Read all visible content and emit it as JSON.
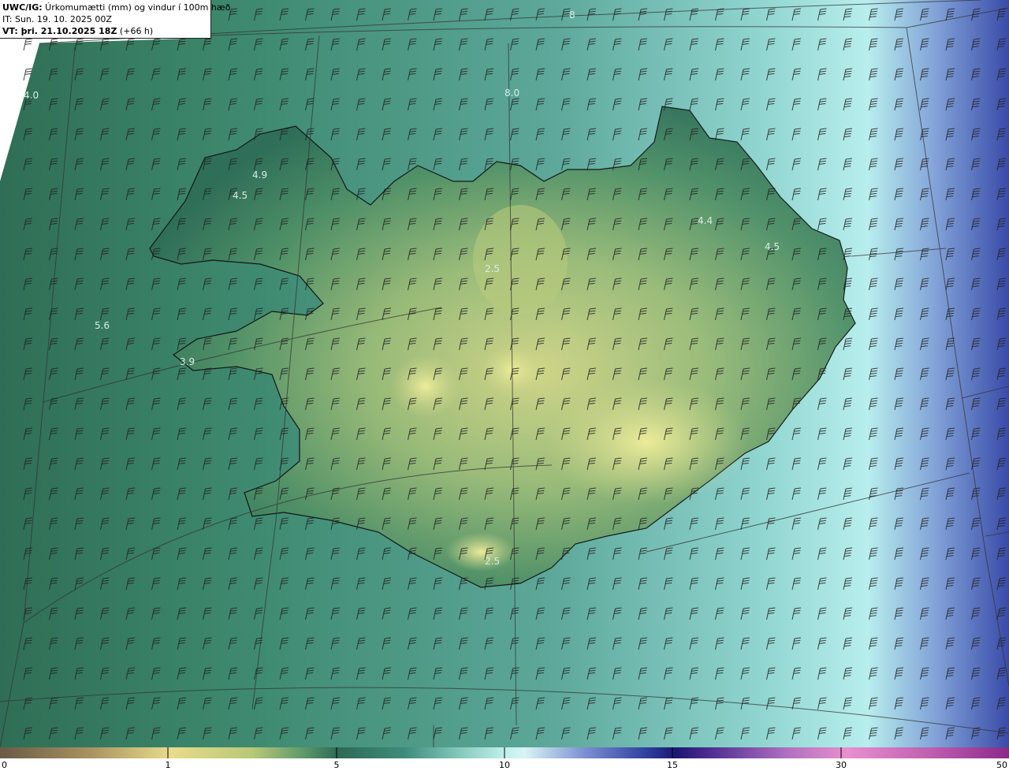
{
  "header": {
    "model": "UWC/IG:",
    "title": " Úrkomumætti (mm) og vindur í 100m hæð",
    "init_time": "IT: Sun. 19. 10. 2025 00Z",
    "valid_label": "VT: þri. 21.10.2025 18Z",
    "lead": " (+66 h)"
  },
  "map_labels": [
    "4.0",
    "8.0",
    "4.5",
    "4.9",
    "5.6",
    "3.9",
    "2.5",
    "4.4",
    "4.5",
    "2.5",
    "8"
  ],
  "colorbar": {
    "ticks": [
      "0",
      "1",
      "5",
      "10",
      "15",
      "30",
      "50"
    ],
    "colors": [
      "#6b5a45",
      "#a89360",
      "#e8dc8a",
      "#b8c878",
      "#5f9a6a",
      "#2d6a55",
      "#3e8b7a",
      "#7cc4b6",
      "#bff0ec",
      "#d8f4f6",
      "#7b8fd0",
      "#3040a0",
      "#1a1870",
      "#4a2a90",
      "#b070c0",
      "#e890d0",
      "#c060b0",
      "#8a2a8a"
    ]
  }
}
